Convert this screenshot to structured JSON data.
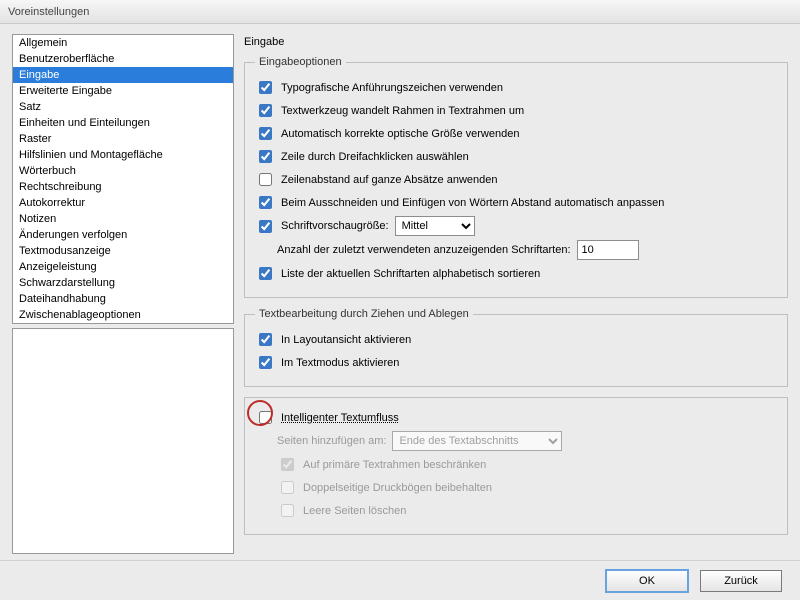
{
  "window": {
    "title": "Voreinstellungen"
  },
  "sidebar": {
    "items": [
      "Allgemein",
      "Benutzeroberfläche",
      "Eingabe",
      "Erweiterte Eingabe",
      "Satz",
      "Einheiten und Einteilungen",
      "Raster",
      "Hilfslinien und Montagefläche",
      "Wörterbuch",
      "Rechtschreibung",
      "Autokorrektur",
      "Notizen",
      "Änderungen verfolgen",
      "Textmodusanzeige",
      "Anzeigeleistung",
      "Schwarzdarstellung",
      "Dateihandhabung",
      "Zwischenablageoptionen"
    ],
    "selected_index": 2
  },
  "page": {
    "title": "Eingabe",
    "group_options": {
      "legend": "Eingabeoptionen",
      "typographic_quotes": {
        "label": "Typografische Anführungszeichen verwenden",
        "checked": true
      },
      "text_tool_convert": {
        "label": "Textwerkzeug wandelt Rahmen in Textrahmen um",
        "checked": true
      },
      "auto_optical_size": {
        "label": "Automatisch korrekte optische Größe verwenden",
        "checked": true
      },
      "triple_click_line": {
        "label": "Zeile durch Dreifachklicken auswählen",
        "checked": true
      },
      "leading_paragraph": {
        "label": "Zeilenabstand auf ganze Absätze anwenden",
        "checked": false
      },
      "cut_paste_spacing": {
        "label": "Beim Ausschneiden und Einfügen von Wörtern Abstand automatisch anpassen",
        "checked": true
      },
      "font_preview": {
        "label": "Schriftvorschaugröße:",
        "checked": true,
        "combo_value": "Mittel"
      },
      "recent_fonts": {
        "label": "Anzahl der zuletzt verwendeten anzuzeigenden Schriftarten:",
        "value": "10"
      },
      "sort_fonts": {
        "label": "Liste der aktuellen Schriftarten alphabetisch sortieren",
        "checked": true
      }
    },
    "group_dragdrop": {
      "legend": "Textbearbeitung durch Ziehen und Ablegen",
      "layout_view": {
        "label": "In Layoutansicht aktivieren",
        "checked": true
      },
      "story_editor": {
        "label": "Im Textmodus aktivieren",
        "checked": true
      }
    },
    "group_reflow": {
      "legend": "",
      "smart_reflow": {
        "label": "Intelligenter Textumfluss",
        "checked": false
      },
      "add_pages": {
        "label": "Seiten hinzufügen am:",
        "combo_value": "Ende des Textabschnitts"
      },
      "primary_frames": {
        "label": "Auf primäre Textrahmen beschränken",
        "checked": true
      },
      "preserve_spreads": {
        "label": "Doppelseitige Druckbögen beibehalten",
        "checked": false
      },
      "delete_empty": {
        "label": "Leere Seiten löschen",
        "checked": false
      }
    }
  },
  "buttons": {
    "ok": "OK",
    "back": "Zurück"
  }
}
